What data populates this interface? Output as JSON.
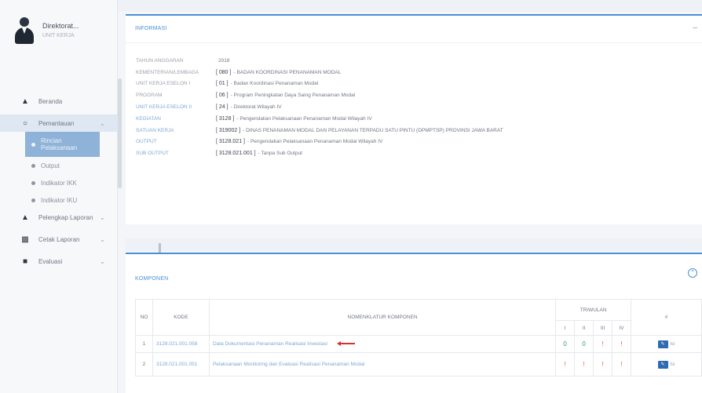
{
  "user": {
    "name": "Direktorat...",
    "role": "UNIT KERJA"
  },
  "sidebar": {
    "items": [
      {
        "label": "Beranda",
        "icon": "home-icon"
      },
      {
        "label": "Pemantauan",
        "icon": "circle-icon"
      },
      {
        "label": "Rincian Pelaksanaan",
        "icon": "dot-icon"
      },
      {
        "label": "Output",
        "icon": "dot-icon"
      },
      {
        "label": "Indikator IKK",
        "icon": "dot-icon"
      },
      {
        "label": "Indikator IKU",
        "icon": "dot-icon"
      },
      {
        "label": "Pelengkap Laporan",
        "icon": "binoculars-icon"
      },
      {
        "label": "Cetak Laporan",
        "icon": "printer-icon"
      },
      {
        "label": "Evaluasi",
        "icon": "chart-icon"
      }
    ]
  },
  "info": {
    "title": "INFORMASI",
    "rows": [
      {
        "key": "TAHUN ANGGARAN",
        "code": "",
        "value": "2018"
      },
      {
        "key": "KEMENTERIAN/LEMBAGA",
        "code": "[ 080 ]",
        "value": "- BADAN KOORDINASI PENANAMAN MODAL"
      },
      {
        "key": "UNIT KERJA ESELON I",
        "code": "[ 01 ]",
        "value": "- Badan Koordinasi Penanaman Modal"
      },
      {
        "key": "PROGRAM",
        "code": "[ 06 ]",
        "value": "- Program Peningkatan Daya Saing Penanaman Modal"
      },
      {
        "key": "UNIT KERJA ESELON II",
        "code": "[ 24 ]",
        "value": "- Direktorat Wilayah IV"
      },
      {
        "key": "KEGIATAN",
        "code": "[ 3128 ]",
        "value": "- Pengendalian Pelaksanaan Penanaman Modal Wilayah IV"
      },
      {
        "key": "SATUAN KERJA",
        "code": "[ 319002 ]",
        "value": "- DINAS PENANAMAN MODAL DAN PELAYANAN TERPADU SATU PINTU (DPMPTSP) PROVINSI JAWA BARAT"
      },
      {
        "key": "OUTPUT",
        "code": "[ 3128.021 ]",
        "value": "- Pengendalian Pelaksanaan Penanaman Modal Wilayah IV"
      },
      {
        "key": "SUB OUTPUT",
        "code": "[ 3128.021.001 ]",
        "value": "- Tanpa Sub Output"
      }
    ]
  },
  "komponen": {
    "title": "KOMPONEN",
    "headers": {
      "no": "NO",
      "kode": "KODE",
      "nomenklatur": "NOMENKLATUR KOMPONEN",
      "triwulan": "TRIWULAN",
      "action": "#"
    },
    "quarters": [
      "I",
      "II",
      "III",
      "IV"
    ],
    "rows": [
      {
        "no": "1",
        "kode": "3128.021.001.058",
        "nomenklatur": "Data Dokumentasi Penanaman Realisasi Investasi",
        "q": [
          "0",
          "0",
          "!",
          "!"
        ],
        "q_status": [
          "ok",
          "ok",
          "warn",
          "warn"
        ],
        "action": "Isi"
      },
      {
        "no": "2",
        "kode": "3128.021.001.051",
        "nomenklatur": "Pelaksanaan Monitoring dan Evaluasi Realisasi Penanaman Modal",
        "q": [
          "!",
          "!",
          "!",
          "!"
        ],
        "q_status": [
          "warn",
          "warn",
          "warn",
          "warn"
        ],
        "action": "Isi"
      }
    ]
  },
  "colors": {
    "accent": "#4a90d9",
    "ok": "#2fa060",
    "warn": "#e0554e",
    "pointer_arrow": "#d7322b"
  }
}
